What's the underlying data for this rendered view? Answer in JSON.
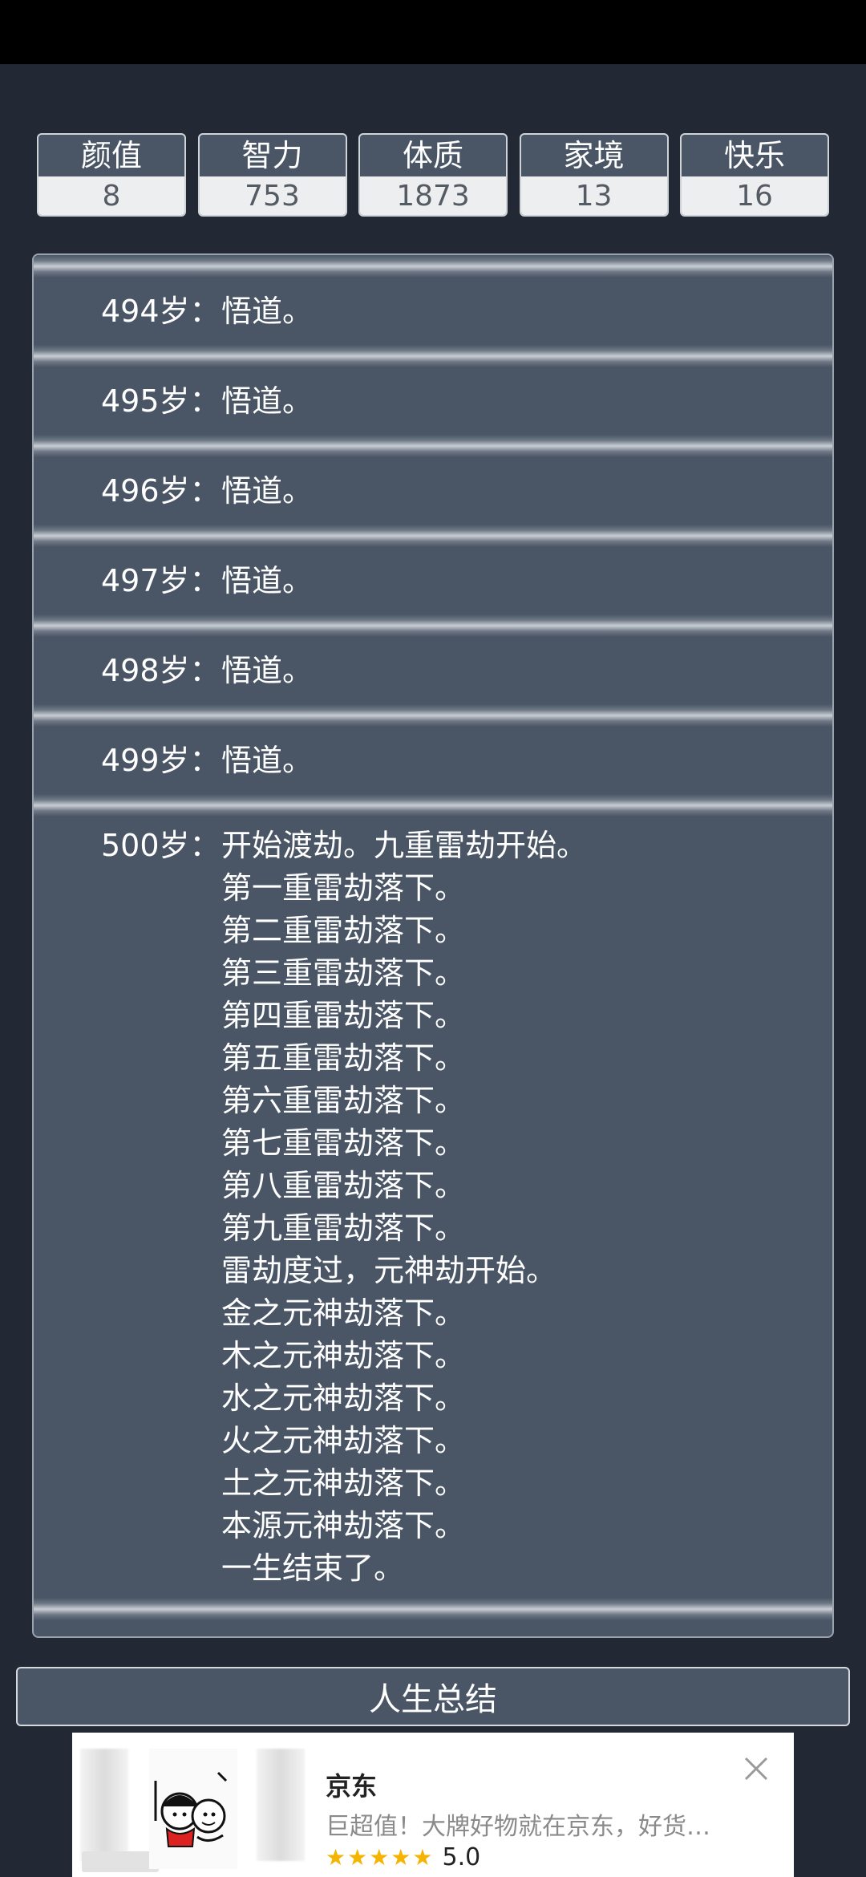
{
  "stats": [
    {
      "name": "颜值",
      "value": "8"
    },
    {
      "name": "智力",
      "value": "753"
    },
    {
      "name": "体质",
      "value": "1873"
    },
    {
      "name": "家境",
      "value": "13"
    },
    {
      "name": "快乐",
      "value": "16"
    }
  ],
  "log": [
    {
      "age": "494岁：",
      "events": [
        "悟道。"
      ]
    },
    {
      "age": "495岁：",
      "events": [
        "悟道。"
      ]
    },
    {
      "age": "496岁：",
      "events": [
        "悟道。"
      ]
    },
    {
      "age": "497岁：",
      "events": [
        "悟道。"
      ]
    },
    {
      "age": "498岁：",
      "events": [
        "悟道。"
      ]
    },
    {
      "age": "499岁：",
      "events": [
        "悟道。"
      ]
    },
    {
      "age": "500岁：",
      "events": [
        "开始渡劫。九重雷劫开始。",
        "第一重雷劫落下。",
        "第二重雷劫落下。",
        "第三重雷劫落下。",
        "第四重雷劫落下。",
        "第五重雷劫落下。",
        "第六重雷劫落下。",
        "第七重雷劫落下。",
        "第八重雷劫落下。",
        "第九重雷劫落下。",
        "雷劫度过，元神劫开始。",
        "金之元神劫落下。",
        "木之元神劫落下。",
        "水之元神劫落下。",
        "火之元神劫落下。",
        "土之元神劫落下。",
        "本源元神劫落下。",
        "一生结束了。"
      ]
    }
  ],
  "summary_button": "人生总结",
  "ad": {
    "title": "京东",
    "description": "巨超值！大牌好物就在京东，好货…",
    "stars": "★★★★★",
    "rating": "5.0",
    "close_icon": "close-icon"
  }
}
